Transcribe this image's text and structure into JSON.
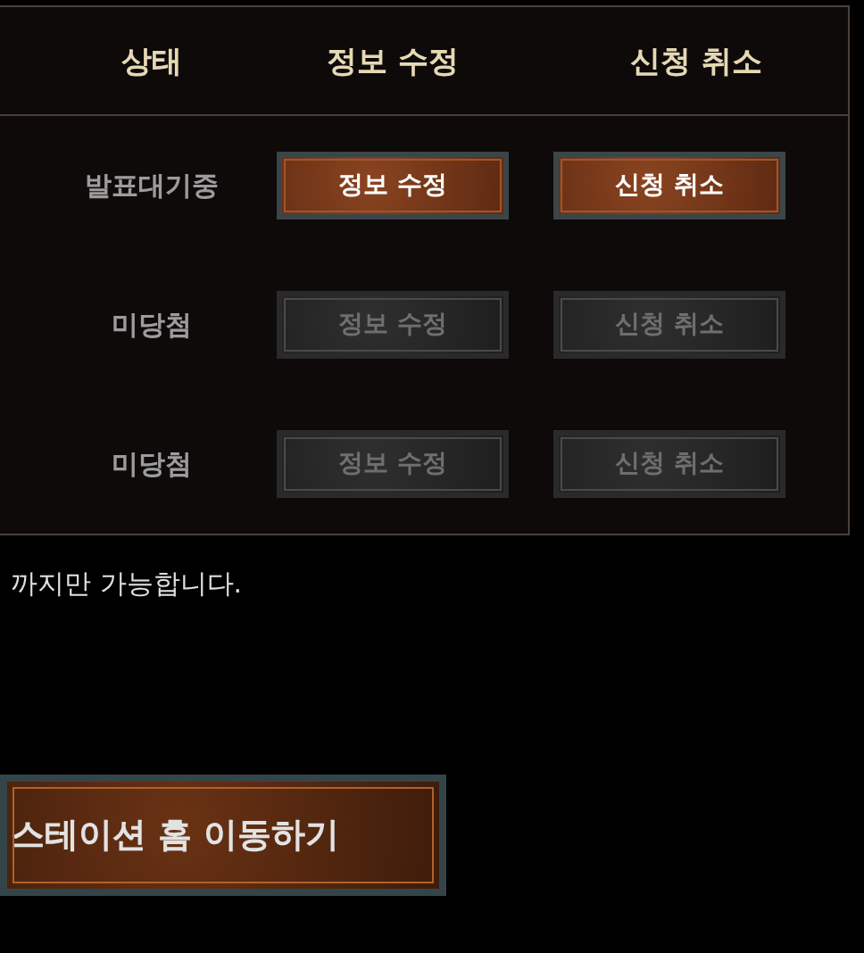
{
  "table": {
    "columns": [
      "상태",
      "정보 수정",
      "신청 취소"
    ],
    "rows": [
      {
        "status": "발표대기중",
        "edit": {
          "label": "정보 수정",
          "disabled": false
        },
        "cancel": {
          "label": "신청 취소",
          "disabled": false
        }
      },
      {
        "status": "미당첨",
        "edit": {
          "label": "정보 수정",
          "disabled": true
        },
        "cancel": {
          "label": "신청 취소",
          "disabled": true
        }
      },
      {
        "status": "미당첨",
        "edit": {
          "label": "정보 수정",
          "disabled": true
        },
        "cancel": {
          "label": "신청 취소",
          "disabled": true
        }
      }
    ]
  },
  "notice": "까지만 가능합니다.",
  "home_button": "스테이션 홈 이동하기"
}
